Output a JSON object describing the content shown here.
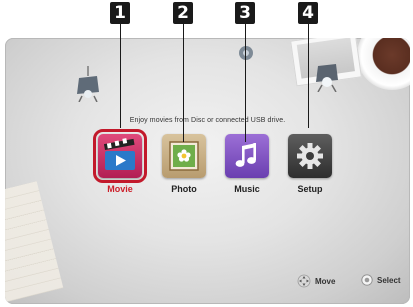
{
  "callouts": [
    "1",
    "2",
    "3",
    "4"
  ],
  "hint": "Enjoy movies from Disc or connected USB drive.",
  "menu": {
    "items": [
      {
        "label": "Movie",
        "icon": "movie-clapper-icon",
        "selected": true
      },
      {
        "label": "Photo",
        "icon": "photo-flower-icon",
        "selected": false
      },
      {
        "label": "Music",
        "icon": "music-note-icon",
        "selected": false
      },
      {
        "label": "Setup",
        "icon": "gear-icon",
        "selected": false
      }
    ]
  },
  "footer": {
    "move_label": "Move",
    "select_label": "Select"
  },
  "colors": {
    "selection": "#c2192b",
    "selected_text": "#cc1f2a"
  }
}
